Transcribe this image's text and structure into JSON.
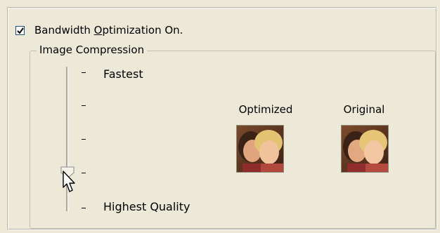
{
  "checkbox": {
    "checked": true,
    "label_before": "Bandwidth ",
    "label_accel": "O",
    "label_after": "ptimization On."
  },
  "group": {
    "title": "Image Compression"
  },
  "slider": {
    "level_index_from_top": 3,
    "tick_count": 5,
    "labels": {
      "top": "Fastest",
      "bottom": "Highest Quality"
    }
  },
  "previews": [
    {
      "title": "Optimized"
    },
    {
      "title": "Original"
    }
  ],
  "icons": {
    "checkbox_check": "check-icon",
    "slider_thumb": "slider-thumb-icon",
    "cursor": "mouse-pointer-icon"
  },
  "colors": {
    "background": "#ece9d8",
    "checkbox_border": "#1c5180"
  }
}
